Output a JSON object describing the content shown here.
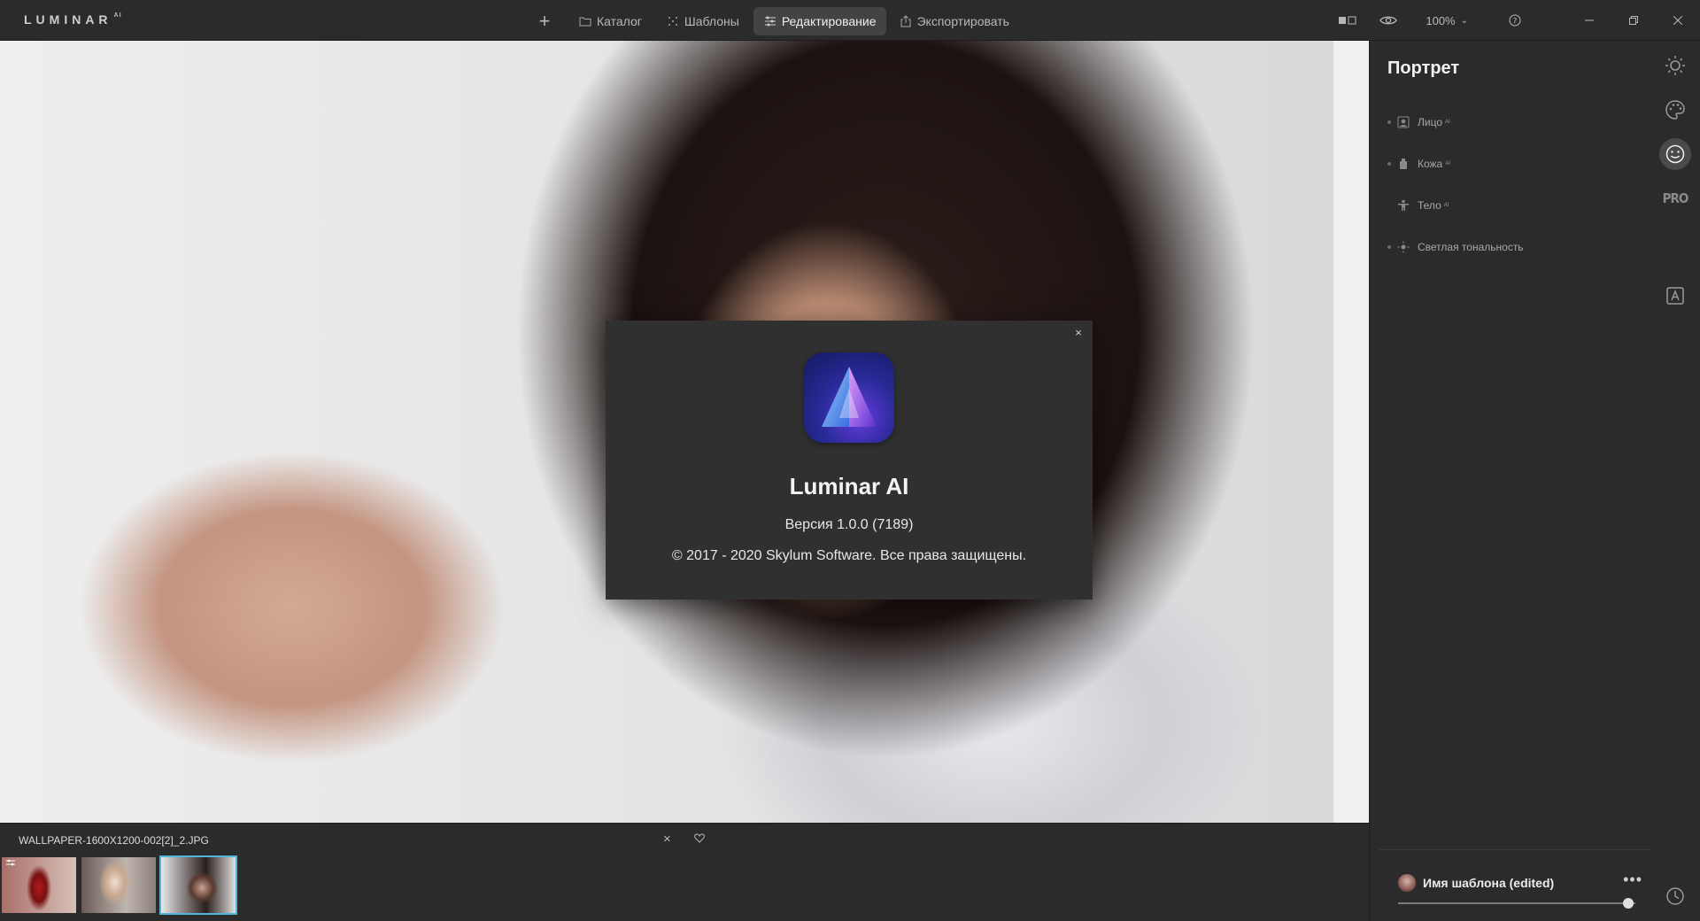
{
  "app": {
    "logo_text": "LUMINAR",
    "logo_sup": "AI"
  },
  "nav": {
    "plus_label": "+",
    "items": [
      {
        "label": "Каталог",
        "icon": "folder-icon"
      },
      {
        "label": "Шаблоны",
        "icon": "templates-icon"
      },
      {
        "label": "Редактирование",
        "icon": "sliders-icon",
        "active": true
      },
      {
        "label": "Экспортировать",
        "icon": "export-icon"
      }
    ]
  },
  "toolbar_right": {
    "zoom_label": "100%",
    "icons": [
      "compare-icon",
      "eye-icon",
      "chevron-down-icon",
      "help-icon",
      "minimize-icon",
      "restore-icon",
      "close-icon"
    ]
  },
  "dialog": {
    "title": "Luminar AI",
    "version": "Версия 1.0.0 (7189)",
    "copyright": "© 2017 - 2020 Skylum Software. Все права защищены.",
    "close_label": "×"
  },
  "panel": {
    "title": "Портрет",
    "tools": [
      {
        "label": "Лицо",
        "sup": "AI",
        "icon": "face-icon",
        "dot": true
      },
      {
        "label": "Кожа",
        "sup": "AI",
        "icon": "skin-icon",
        "dot": true
      },
      {
        "label": "Тело",
        "sup": "AI",
        "icon": "body-icon",
        "dot": false
      },
      {
        "label": "Светлая тональность",
        "sup": "",
        "icon": "high-key-icon",
        "dot": true
      }
    ]
  },
  "template": {
    "name": "Имя шаблона (edited)",
    "more_label": "•••",
    "slider_value": 0.97
  },
  "rail": {
    "pro_label": "PRO",
    "icons": [
      "sun-icon",
      "palette-icon",
      "smile-icon",
      "pro-icon",
      "canvas-icon",
      "history-icon"
    ],
    "active": "smile-icon"
  },
  "filmstrip": {
    "file_name": "WALLPAPER-1600X1200-002[2]_2.JPG",
    "close_label": "×",
    "thumbnails": [
      "thumbnail-1",
      "thumbnail-2",
      "thumbnail-3"
    ],
    "selected": 2
  },
  "colors": {
    "accent": "#4fb6d8",
    "background": "#2b2b2c",
    "active_tab": "#434345"
  }
}
